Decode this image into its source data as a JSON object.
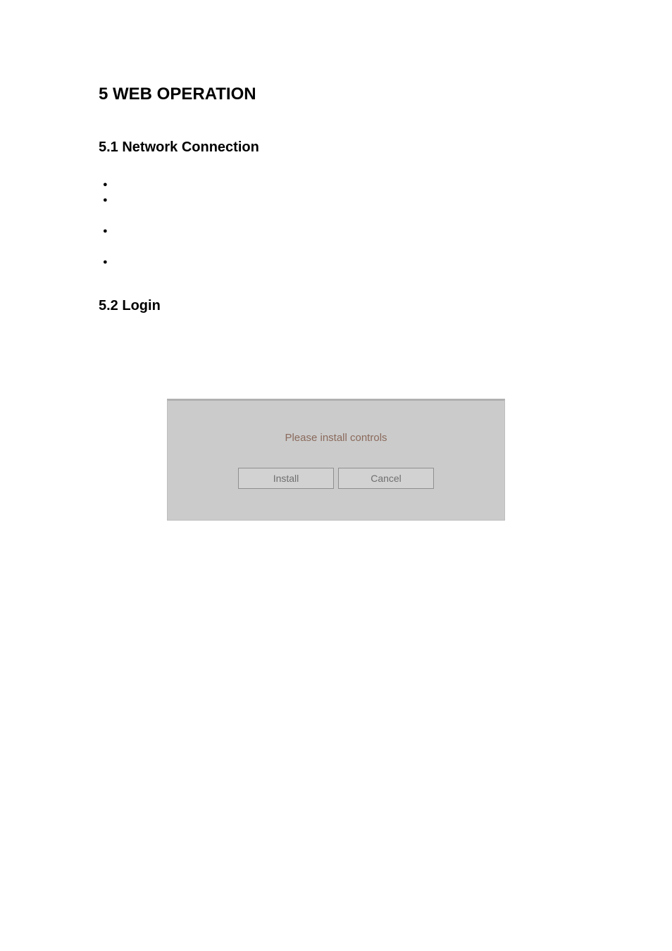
{
  "headings": {
    "chapter": "5  WEB OPERATION",
    "section_5_1": "5.1  Network Connection",
    "section_5_2": "5.2  Login"
  },
  "bullets": {
    "b1": "",
    "b2": "",
    "b3": "",
    "b4": ""
  },
  "dialog": {
    "message": "Please install controls",
    "install_label": "Install",
    "cancel_label": "Cancel"
  }
}
